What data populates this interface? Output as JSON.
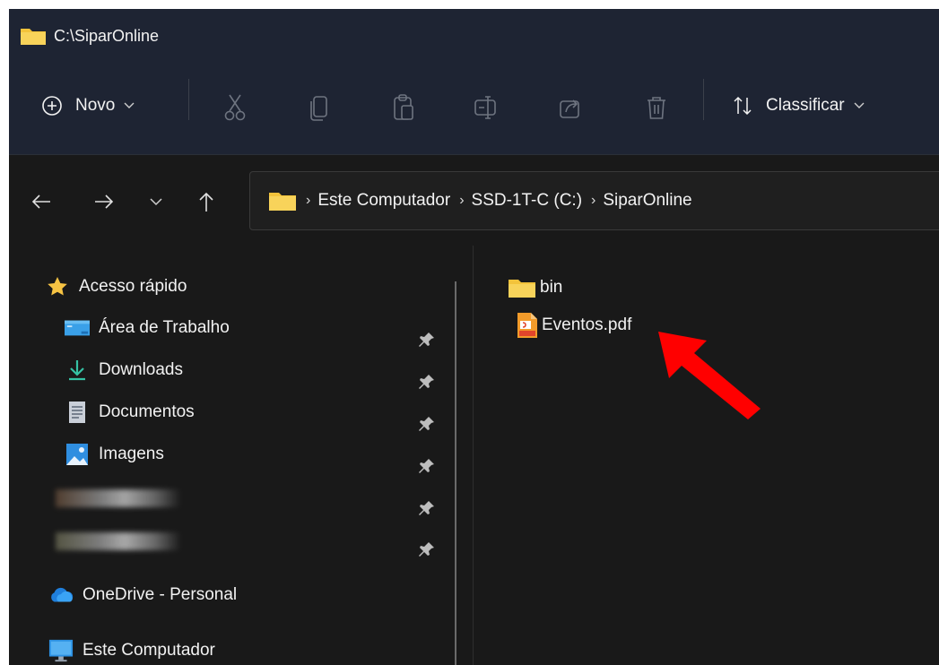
{
  "window": {
    "title": "C:\\SiparOnline"
  },
  "toolbar": {
    "new_label": "Novo",
    "sort_label": "Classificar",
    "tools": [
      "scissors-icon",
      "copy-icon",
      "paste-icon",
      "rename-icon",
      "share-icon",
      "trash-icon"
    ]
  },
  "address": {
    "crumbs": [
      "Este Computador",
      "SSD-1T-C (C:)",
      "SiparOnline"
    ]
  },
  "sidebar": {
    "quick_access": "Acesso rápido",
    "items": [
      {
        "label": "Área de Trabalho",
        "icon": "desktop-icon"
      },
      {
        "label": "Downloads",
        "icon": "download-icon"
      },
      {
        "label": "Documentos",
        "icon": "document-icon"
      },
      {
        "label": "Imagens",
        "icon": "image-icon"
      }
    ],
    "onedrive": "OneDrive - Personal",
    "this_pc": "Este Computador"
  },
  "files": [
    {
      "name": "bin",
      "type": "folder"
    },
    {
      "name": "Eventos.pdf",
      "type": "pdf"
    }
  ],
  "colors": {
    "accent_folder": "#f3c33b",
    "annotation_arrow": "#ff0000",
    "titlebar_bg": "#1e2433",
    "window_bg": "#191919"
  }
}
